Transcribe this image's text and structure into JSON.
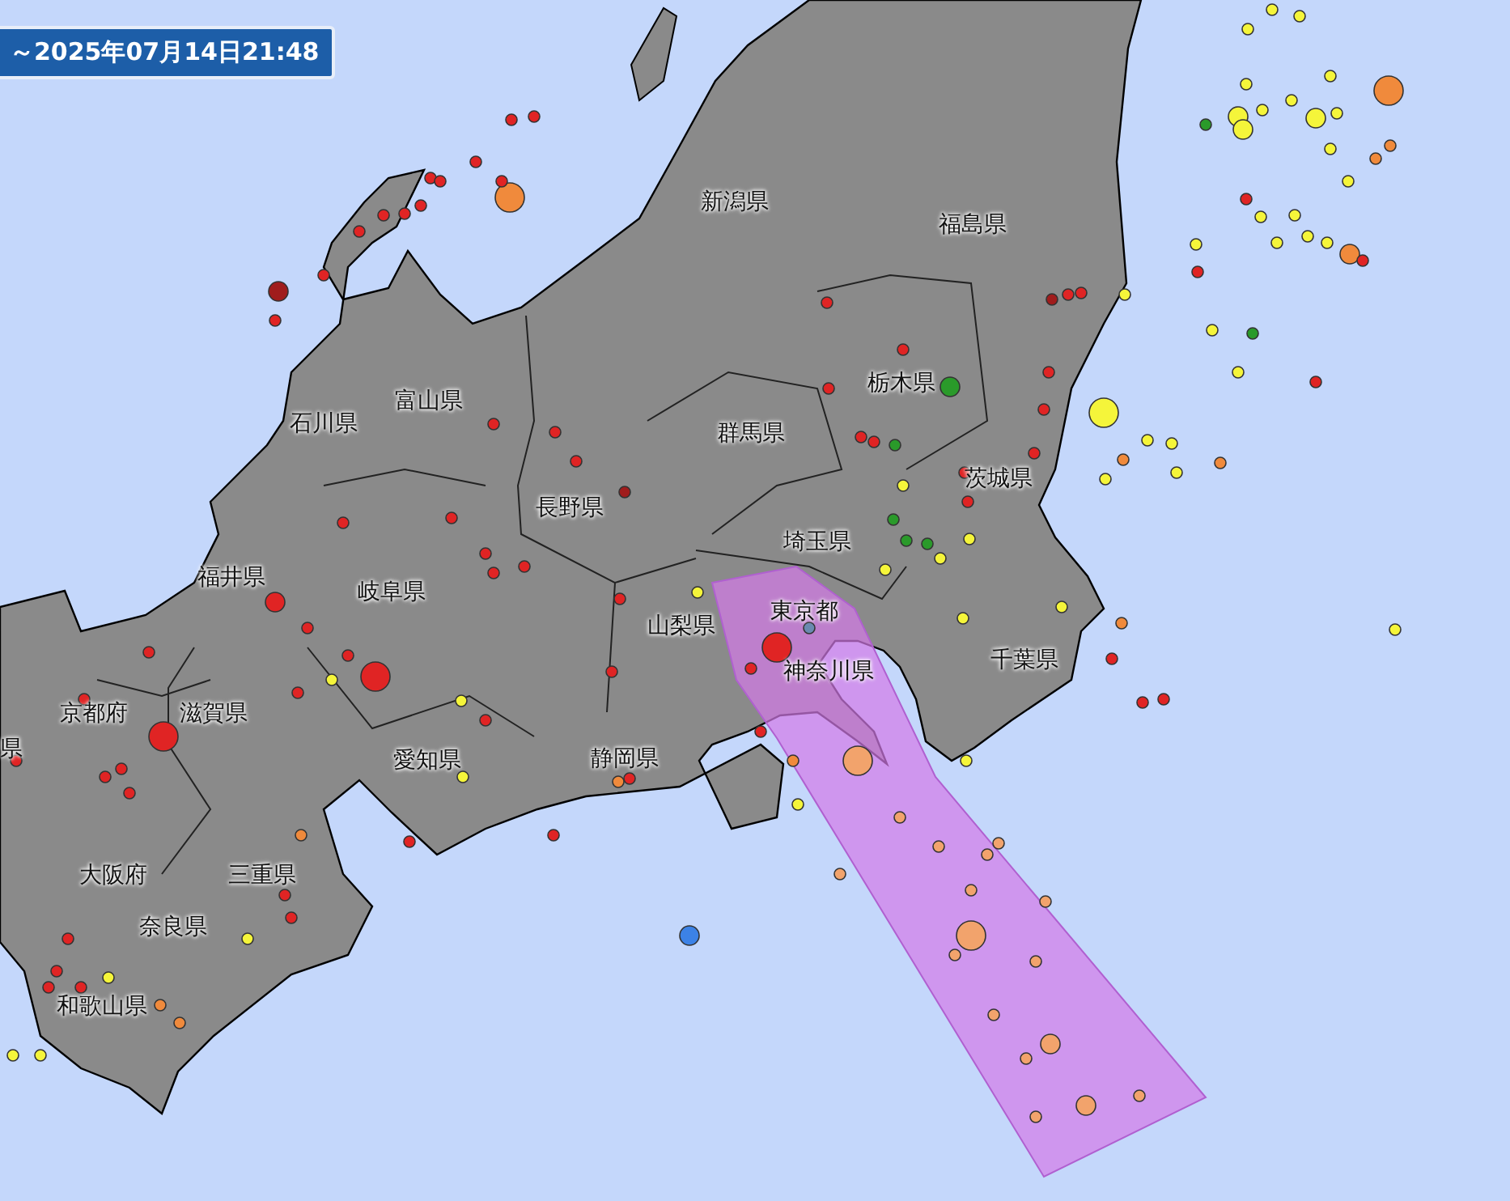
{
  "time_range": "～2025年07月14日21:48",
  "prefecture_labels": [
    {
      "name": "新潟県"
    },
    {
      "name": "福島県"
    },
    {
      "name": "栃木県"
    },
    {
      "name": "群馬県"
    },
    {
      "name": "茨城県"
    },
    {
      "name": "埼玉県"
    },
    {
      "name": "東京都"
    },
    {
      "name": "千葉県"
    },
    {
      "name": "神奈川県"
    },
    {
      "name": "山梨県"
    },
    {
      "name": "長野県"
    },
    {
      "name": "富山県"
    },
    {
      "name": "石川県"
    },
    {
      "name": "福井県"
    },
    {
      "name": "岐阜県"
    },
    {
      "name": "愛知県"
    },
    {
      "name": "静岡県"
    },
    {
      "name": "滋賀県"
    },
    {
      "name": "京都府"
    },
    {
      "name": "大阪府"
    },
    {
      "name": "三重県"
    },
    {
      "name": "奈良県"
    },
    {
      "name": "和歌山県"
    },
    {
      "name": "県"
    }
  ],
  "quake_markers": [
    {
      "color": "#f5f53a",
      "kind": "s"
    },
    {
      "color": "#f5f53a",
      "kind": "s"
    },
    {
      "color": "#f5f53a",
      "kind": "s"
    },
    {
      "color": "#f5f53a",
      "kind": "s"
    },
    {
      "color": "#f5f53a",
      "kind": "s"
    },
    {
      "color": "#f08a3c",
      "kind": "l"
    },
    {
      "color": "#2a9a2a",
      "kind": "s"
    },
    {
      "color": "#f5f53a",
      "kind": "m"
    },
    {
      "color": "#f5f53a",
      "kind": "m"
    },
    {
      "color": "#f5f53a",
      "kind": "s"
    },
    {
      "color": "#f5f53a",
      "kind": "s"
    },
    {
      "color": "#f5f53a",
      "kind": "m"
    },
    {
      "color": "#f5f53a",
      "kind": "s"
    },
    {
      "color": "#f5f53a",
      "kind": "s"
    },
    {
      "color": "#f08a3c",
      "kind": "s"
    },
    {
      "color": "#f08a3c",
      "kind": "s"
    },
    {
      "color": "#f5f53a",
      "kind": "s"
    },
    {
      "color": "#e02424",
      "kind": "s"
    },
    {
      "color": "#f5f53a",
      "kind": "s"
    },
    {
      "color": "#f5f53a",
      "kind": "s"
    },
    {
      "color": "#f5f53a",
      "kind": "s"
    },
    {
      "color": "#f5f53a",
      "kind": "s"
    },
    {
      "color": "#f08a3c",
      "kind": "m"
    },
    {
      "color": "#e02424",
      "kind": "s"
    },
    {
      "color": "#f5f53a",
      "kind": "s"
    },
    {
      "color": "#f5f53a",
      "kind": "s"
    },
    {
      "color": "#e02424",
      "kind": "s"
    },
    {
      "color": "#f5f53a",
      "kind": "s"
    },
    {
      "color": "#f5f53a",
      "kind": "s"
    },
    {
      "color": "#2a9a2a",
      "kind": "s"
    },
    {
      "color": "#e02424",
      "kind": "s"
    },
    {
      "color": "#f5f53a",
      "kind": "s"
    },
    {
      "color": "#f5f53a",
      "kind": "l"
    },
    {
      "color": "#f5f53a",
      "kind": "s"
    },
    {
      "color": "#f5f53a",
      "kind": "s"
    },
    {
      "color": "#f5f53a",
      "kind": "s"
    },
    {
      "color": "#f08a3c",
      "kind": "s"
    },
    {
      "color": "#f5f53a",
      "kind": "s"
    },
    {
      "color": "#f08a3c",
      "kind": "s"
    },
    {
      "color": "#f5f53a",
      "kind": "s"
    },
    {
      "color": "#f08a3c",
      "kind": "s"
    },
    {
      "color": "#e02424",
      "kind": "s"
    },
    {
      "color": "#e02424",
      "kind": "s"
    },
    {
      "color": "#e02424",
      "kind": "s"
    },
    {
      "color": "#f5f53a",
      "kind": "s"
    },
    {
      "color": "#e02424",
      "kind": "s"
    },
    {
      "color": "#e02424",
      "kind": "s"
    },
    {
      "color": "#e02424",
      "kind": "s"
    },
    {
      "color": "#f08a3c",
      "kind": "l"
    },
    {
      "color": "#e02424",
      "kind": "s"
    },
    {
      "color": "#e02424",
      "kind": "s"
    },
    {
      "color": "#e02424",
      "kind": "s"
    },
    {
      "color": "#e02424",
      "kind": "s"
    },
    {
      "color": "#e02424",
      "kind": "s"
    },
    {
      "color": "#e02424",
      "kind": "s"
    },
    {
      "color": "#e02424",
      "kind": "s"
    },
    {
      "color": "#a01c1c",
      "kind": "m"
    },
    {
      "color": "#e02424",
      "kind": "s"
    },
    {
      "color": "#e02424",
      "kind": "s"
    },
    {
      "color": "#e02424",
      "kind": "s"
    },
    {
      "color": "#e02424",
      "kind": "s"
    },
    {
      "color": "#e02424",
      "kind": "s"
    },
    {
      "color": "#a01c1c",
      "kind": "s"
    },
    {
      "color": "#e02424",
      "kind": "s"
    },
    {
      "color": "#e02424",
      "kind": "s"
    },
    {
      "color": "#e02424",
      "kind": "s"
    },
    {
      "color": "#e02424",
      "kind": "s"
    },
    {
      "color": "#e02424",
      "kind": "s"
    },
    {
      "color": "#e02424",
      "kind": "m"
    },
    {
      "color": "#e02424",
      "kind": "s"
    },
    {
      "color": "#e02424",
      "kind": "l"
    },
    {
      "color": "#e02424",
      "kind": "s"
    },
    {
      "color": "#f5f53a",
      "kind": "s"
    },
    {
      "color": "#e02424",
      "kind": "s"
    },
    {
      "color": "#e02424",
      "kind": "s"
    },
    {
      "color": "#e02424",
      "kind": "s"
    },
    {
      "color": "#e02424",
      "kind": "l"
    },
    {
      "color": "#e02424",
      "kind": "s"
    },
    {
      "color": "#e02424",
      "kind": "s"
    },
    {
      "color": "#e02424",
      "kind": "s"
    },
    {
      "color": "#e02424",
      "kind": "s"
    },
    {
      "color": "#f5f53a",
      "kind": "s"
    },
    {
      "color": "#e02424",
      "kind": "s"
    },
    {
      "color": "#f5f53a",
      "kind": "s"
    },
    {
      "color": "#e02424",
      "kind": "s"
    },
    {
      "color": "#e02424",
      "kind": "s"
    },
    {
      "color": "#f08a3c",
      "kind": "s"
    },
    {
      "color": "#e02424",
      "kind": "s"
    },
    {
      "color": "#f5f53a",
      "kind": "s"
    },
    {
      "color": "#e02424",
      "kind": "s"
    },
    {
      "color": "#f5f53a",
      "kind": "s"
    },
    {
      "color": "#e02424",
      "kind": "s"
    },
    {
      "color": "#e02424",
      "kind": "s"
    },
    {
      "color": "#e02424",
      "kind": "s"
    },
    {
      "color": "#e02424",
      "kind": "s"
    },
    {
      "color": "#f08a3c",
      "kind": "s"
    },
    {
      "color": "#f5f53a",
      "kind": "s"
    },
    {
      "color": "#f5f53a",
      "kind": "s"
    },
    {
      "color": "#f08a3c",
      "kind": "s"
    },
    {
      "color": "#e02424",
      "kind": "s"
    },
    {
      "color": "#e02424",
      "kind": "s"
    },
    {
      "color": "#e02424",
      "kind": "s"
    },
    {
      "color": "#2a9a2a",
      "kind": "m"
    },
    {
      "color": "#e02424",
      "kind": "s"
    },
    {
      "color": "#e02424",
      "kind": "s"
    },
    {
      "color": "#2a9a2a",
      "kind": "s"
    },
    {
      "color": "#f5f53a",
      "kind": "s"
    },
    {
      "color": "#e02424",
      "kind": "s"
    },
    {
      "color": "#e02424",
      "kind": "s"
    },
    {
      "color": "#2a9a2a",
      "kind": "s"
    },
    {
      "color": "#2a9a2a",
      "kind": "s"
    },
    {
      "color": "#2a9a2a",
      "kind": "s"
    },
    {
      "color": "#f5f53a",
      "kind": "s"
    },
    {
      "color": "#f5f53a",
      "kind": "s"
    },
    {
      "color": "#f5f53a",
      "kind": "s"
    },
    {
      "color": "#a01c1c",
      "kind": "s"
    },
    {
      "color": "#e02424",
      "kind": "s"
    },
    {
      "color": "#e02424",
      "kind": "s"
    },
    {
      "color": "#e02424",
      "kind": "s"
    },
    {
      "color": "#e02424",
      "kind": "s"
    },
    {
      "color": "#e02424",
      "kind": "s"
    },
    {
      "color": "#f5f53a",
      "kind": "s"
    },
    {
      "color": "#f5f53a",
      "kind": "s"
    },
    {
      "color": "#f5f53a",
      "kind": "s"
    },
    {
      "color": "#e02424",
      "kind": "s"
    },
    {
      "color": "#e02424",
      "kind": "s"
    },
    {
      "color": "#f08a3c",
      "kind": "s"
    },
    {
      "color": "#e02424",
      "kind": "s"
    },
    {
      "color": "#e02424",
      "kind": "s"
    },
    {
      "color": "#e02424",
      "kind": "l"
    },
    {
      "color": "#e02424",
      "kind": "s"
    },
    {
      "color": "#6a8ab0",
      "kind": "s"
    },
    {
      "color": "#f08a3c",
      "kind": "s"
    },
    {
      "color": "#f5f53a",
      "kind": "s"
    },
    {
      "color": "#3c82e6",
      "kind": "m"
    },
    {
      "color": "#f2a36c",
      "kind": "l"
    },
    {
      "color": "#f2a36c",
      "kind": "s"
    },
    {
      "color": "#f2a36c",
      "kind": "s"
    },
    {
      "color": "#f2a36c",
      "kind": "s"
    },
    {
      "color": "#f2a36c",
      "kind": "l"
    },
    {
      "color": "#f2a36c",
      "kind": "s"
    },
    {
      "color": "#f2a36c",
      "kind": "s"
    },
    {
      "color": "#f2a36c",
      "kind": "s"
    },
    {
      "color": "#f2a36c",
      "kind": "s"
    },
    {
      "color": "#f2a36c",
      "kind": "s"
    },
    {
      "color": "#f2a36c",
      "kind": "m"
    },
    {
      "color": "#f2a36c",
      "kind": "s"
    },
    {
      "color": "#f2a36c",
      "kind": "m"
    },
    {
      "color": "#f2a36c",
      "kind": "s"
    },
    {
      "color": "#f2a36c",
      "kind": "s"
    },
    {
      "color": "#f2a36c",
      "kind": "s"
    },
    {
      "color": "#f2a36c",
      "kind": "s"
    }
  ]
}
